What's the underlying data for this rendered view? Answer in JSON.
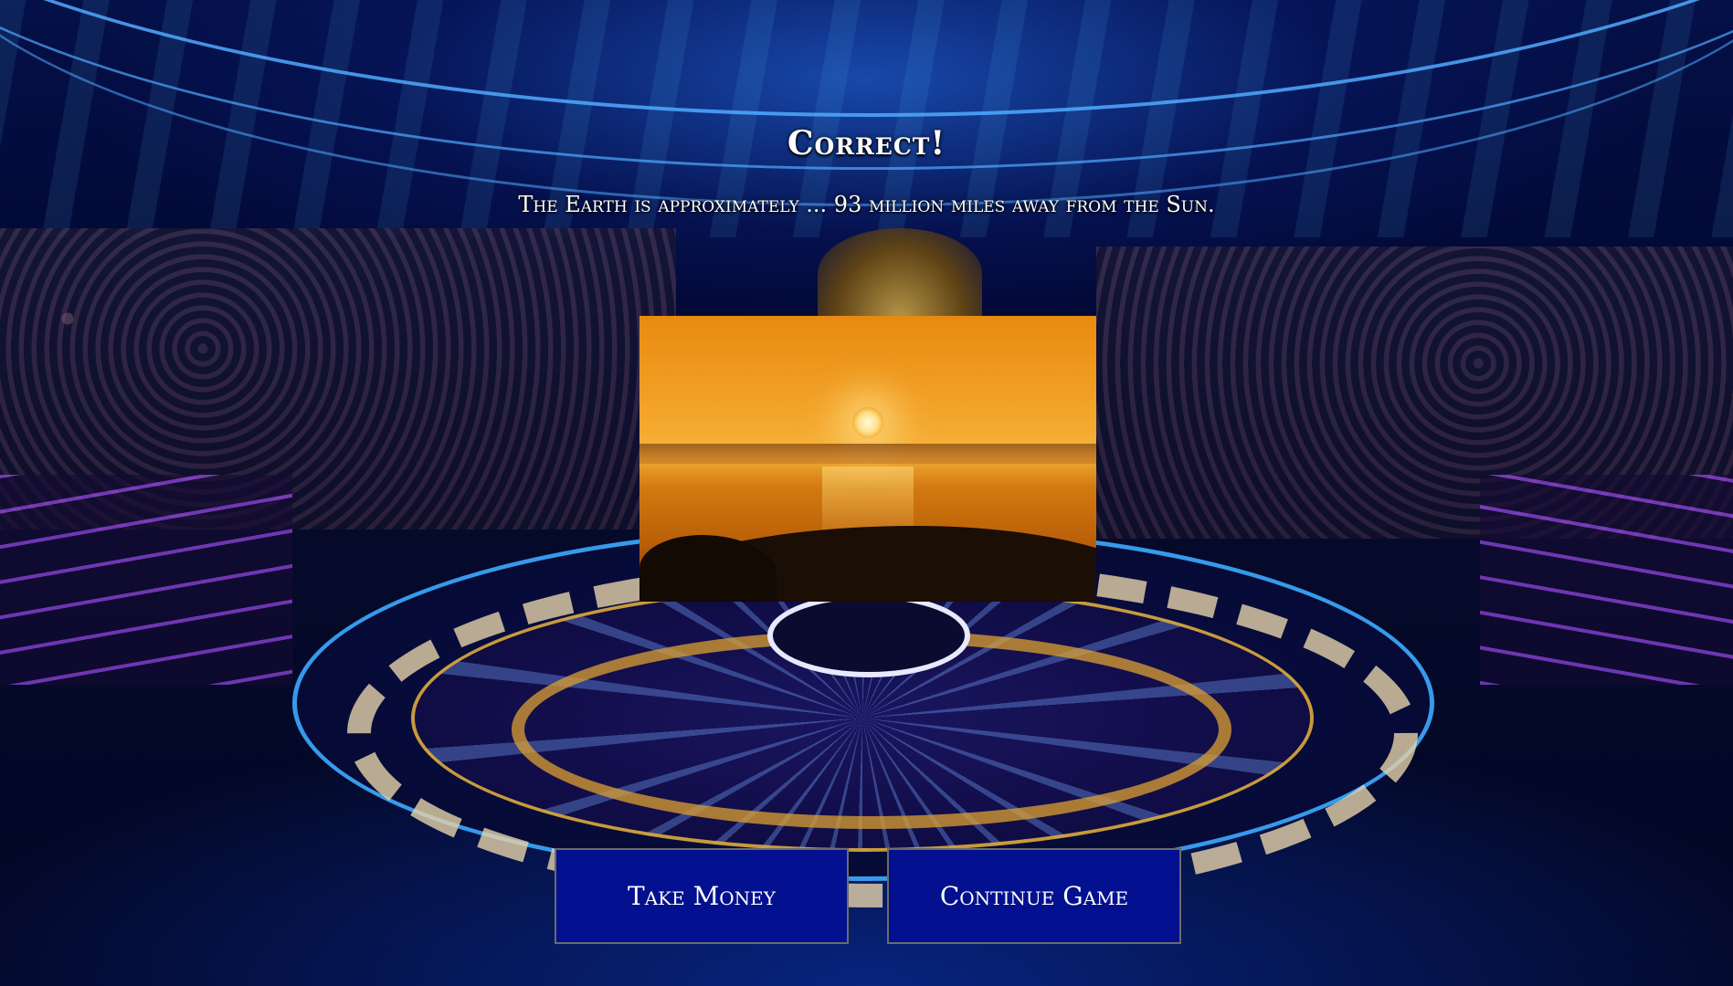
{
  "result": {
    "title": "Correct!",
    "explanation": "The Earth is approximately ... 93 million miles away from the Sun."
  },
  "image": {
    "icon": "sunset-image"
  },
  "buttons": {
    "take_money": "Take Money",
    "continue_game": "Continue Game"
  },
  "colors": {
    "button_bg": "#03108f",
    "text": "#ffffff"
  }
}
